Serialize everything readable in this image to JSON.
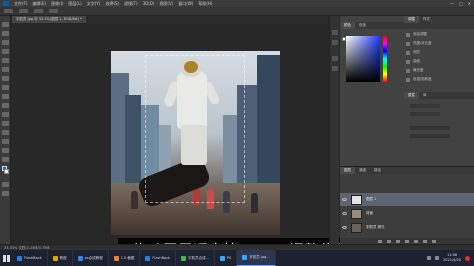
{
  "menubar": {
    "items": [
      "文件(F)",
      "编辑(E)",
      "图像(I)",
      "图层(L)",
      "文字(Y)",
      "选择(S)",
      "滤镜(T)",
      "3D(D)",
      "视图(V)",
      "窗口(W)",
      "帮助(H)"
    ],
    "window_controls": [
      "—",
      "□",
      "✕"
    ]
  },
  "document_tab": {
    "label": "宇航员.jpg @ 33.3%(图层 1, RGB/8#) *"
  },
  "caption": {
    "text": "4.拖动图层顺序按Crtl+T调整位置即可"
  },
  "panels": {
    "top_tabs": [
      "颜色",
      "色板"
    ],
    "mid_tabs": [
      "调整",
      "样式"
    ],
    "adjustments": [
      "添加调整",
      "亮度/对比度",
      "色阶",
      "曲线",
      "曝光度",
      "色相/饱和度"
    ],
    "props_tabs": [
      "属性",
      "库"
    ]
  },
  "layers_panel": {
    "tabs": [
      "图层",
      "通道",
      "路径"
    ],
    "layers": [
      {
        "name": "图层 1",
        "selected": true
      },
      {
        "name": "背景",
        "selected": false
      },
      {
        "name": "宇航员 拷贝",
        "selected": false
      }
    ]
  },
  "statusbar": {
    "text": "33.33%    文档:2.25M/3.75M"
  },
  "taskbar": {
    "items": [
      {
        "label": "FlashBack",
        "color": "#2e7ed8",
        "active": false
      },
      {
        "label": "教程",
        "color": "#e0a800",
        "active": false
      },
      {
        "label": "ps合成教程",
        "color": "#3b82f6",
        "active": false
      },
      {
        "label": "1.5 截图",
        "color": "#f08030",
        "active": false
      },
      {
        "label": "FlashBack",
        "color": "#2e7ed8",
        "active": false
      },
      {
        "label": "宇航员合成...",
        "color": "#4caf50",
        "active": false
      },
      {
        "label": "PS",
        "color": "#31a8ff",
        "active": false
      },
      {
        "label": "宇航员.jpg...",
        "color": "#31a8ff",
        "active": true
      }
    ],
    "clock_time": "11:08",
    "clock_date": "2021/4/20"
  }
}
